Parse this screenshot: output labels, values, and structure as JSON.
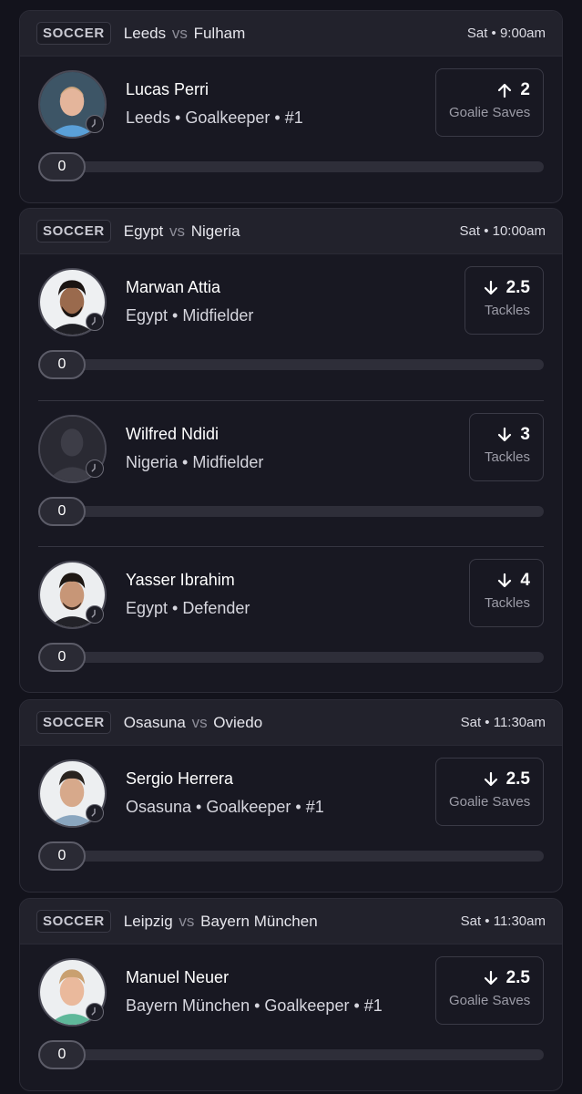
{
  "colors": {
    "background": "#13131c",
    "card": "#181822",
    "header": "#22222c",
    "muted_text": "#9c9ca7"
  },
  "cards": [
    {
      "sport": "SOCCER",
      "team_a": "Leeds",
      "vs": "vs",
      "team_b": "Fulham",
      "time": "Sat • 9:00am",
      "players": [
        {
          "name": "Lucas Perri",
          "meta": "Leeds • Goalkeeper • #1",
          "direction": "up-arrow-icon",
          "line": "2",
          "stat": "Goalie Saves",
          "progress": "0",
          "avatar": "player-photo"
        }
      ]
    },
    {
      "sport": "SOCCER",
      "team_a": "Egypt",
      "vs": "vs",
      "team_b": "Nigeria",
      "time": "Sat • 10:00am",
      "players": [
        {
          "name": "Marwan Attia",
          "meta": "Egypt • Midfielder",
          "direction": "down-arrow-icon",
          "line": "2.5",
          "stat": "Tackles",
          "progress": "0",
          "avatar": "player-photo"
        },
        {
          "name": "Wilfred Ndidi",
          "meta": "Nigeria • Midfielder",
          "direction": "down-arrow-icon",
          "line": "3",
          "stat": "Tackles",
          "progress": "0",
          "avatar": "silhouette"
        },
        {
          "name": "Yasser Ibrahim",
          "meta": "Egypt • Defender",
          "direction": "down-arrow-icon",
          "line": "4",
          "stat": "Tackles",
          "progress": "0",
          "avatar": "player-photo"
        }
      ]
    },
    {
      "sport": "SOCCER",
      "team_a": "Osasuna",
      "vs": "vs",
      "team_b": "Oviedo",
      "time": "Sat • 11:30am",
      "players": [
        {
          "name": "Sergio Herrera",
          "meta": "Osasuna • Goalkeeper • #1",
          "direction": "down-arrow-icon",
          "line": "2.5",
          "stat": "Goalie Saves",
          "progress": "0",
          "avatar": "player-photo"
        }
      ]
    },
    {
      "sport": "SOCCER",
      "team_a": "Leipzig",
      "vs": "vs",
      "team_b": "Bayern München",
      "time": "Sat • 11:30am",
      "players": [
        {
          "name": "Manuel Neuer",
          "meta": "Bayern München • Goalkeeper • #1",
          "direction": "down-arrow-icon",
          "line": "2.5",
          "stat": "Goalie Saves",
          "progress": "0",
          "avatar": "player-photo"
        }
      ]
    }
  ]
}
